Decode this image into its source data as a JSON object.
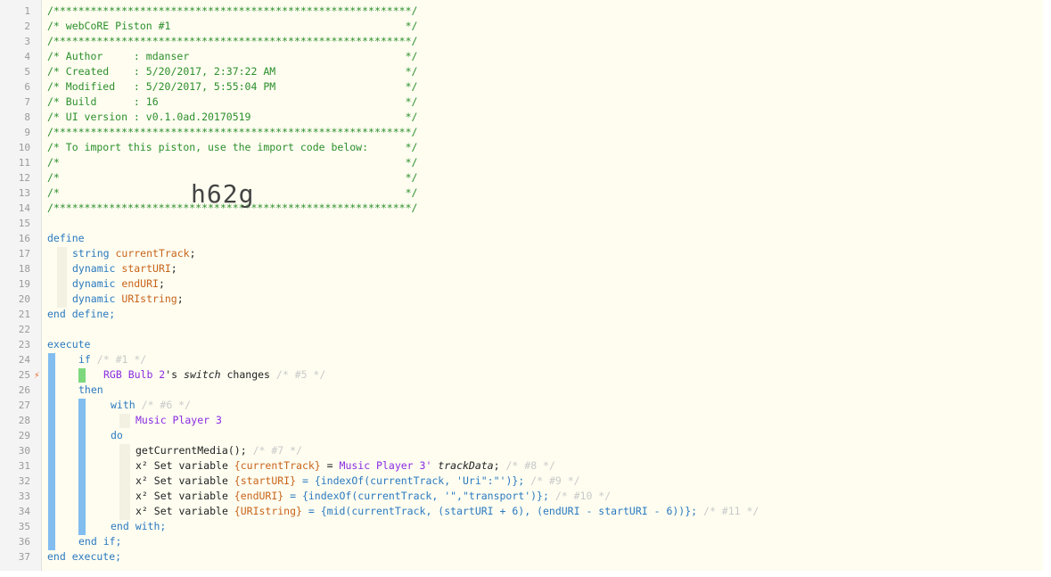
{
  "import_code": "h62g",
  "colors": {
    "comment": "#2c8f2c",
    "type": "#2a79c0",
    "variable": "#c8641a",
    "device": "#8a2be2",
    "trigger_bar": "#7dd87d",
    "block_bar": "#82bdf0",
    "trigger_icon": "#ee6c2e"
  },
  "icons": {
    "trigger": "lightning-bolt-icon"
  },
  "line_numbers": [
    "1",
    "2",
    "3",
    "4",
    "5",
    "6",
    "7",
    "8",
    "9",
    "10",
    "11",
    "12",
    "13",
    "14",
    "15",
    "16",
    "17",
    "18",
    "19",
    "20",
    "21",
    "22",
    "23",
    "24",
    "25",
    "26",
    "27",
    "28",
    "29",
    "30",
    "31",
    "32",
    "33",
    "34",
    "35",
    "36",
    "37"
  ],
  "trigger_marker": "⚡",
  "lines": {
    "l1": "/**********************************************************/",
    "l2": "/* webCoRE Piston #1                                      */",
    "l3": "/**********************************************************/",
    "l4": "/* Author     : mdanser                                   */",
    "l5": "/* Created    : 5/20/2017, 2:37:22 AM                     */",
    "l6": "/* Modified   : 5/20/2017, 5:55:04 PM                     */",
    "l7": "/* Build      : 16                                        */",
    "l8": "/* UI version : v0.1.0ad.20170519                         */",
    "l9": "/**********************************************************/",
    "l10": "/* To import this piston, use the import code below:      */",
    "l11": "/*                                                        */",
    "l12": "/*                                                        */",
    "l13": "/*                                                        */",
    "l14": "/**********************************************************/",
    "l16": "define",
    "l17": [
      "string",
      "currentTrack",
      ";"
    ],
    "l18": [
      "dynamic",
      "startURI",
      ";"
    ],
    "l19": [
      "dynamic",
      "endURI",
      ";"
    ],
    "l20": [
      "dynamic",
      "URIstring",
      ";"
    ],
    "l21": "end define;",
    "l23": "execute",
    "l24": [
      "if",
      "/* #1 */"
    ],
    "l25": [
      "RGB Bulb 2",
      "'s ",
      "switch",
      " changes ",
      "/* #5 */"
    ],
    "l26": "then",
    "l27": [
      "with",
      "/* #6 */"
    ],
    "l28": "Music Player 3",
    "l29": "do",
    "l30": [
      "getCurrentMedia();",
      "/* #7 */"
    ],
    "l31": [
      "x²",
      " Set variable ",
      "{currentTrack}",
      " = ",
      "Music Player 3'",
      " trackData",
      ";",
      "/* #8 */"
    ],
    "l32": [
      "x²",
      " Set variable ",
      "{startURI}",
      " = {indexOf(currentTrack, 'Uri\":\"')};",
      "/* #9 */"
    ],
    "l33": [
      "x²",
      " Set variable ",
      "{endURI}",
      " = {indexOf(currentTrack, '\",\"transport')};",
      "/* #10 */"
    ],
    "l34": [
      "x²",
      " Set variable ",
      "{URIstring}",
      " = {mid(currentTrack, (startURI + 6), (endURI - startURI - 6))};",
      "/* #11 */"
    ],
    "l35": "end with;",
    "l36": "end if;",
    "l37": "end execute;"
  }
}
